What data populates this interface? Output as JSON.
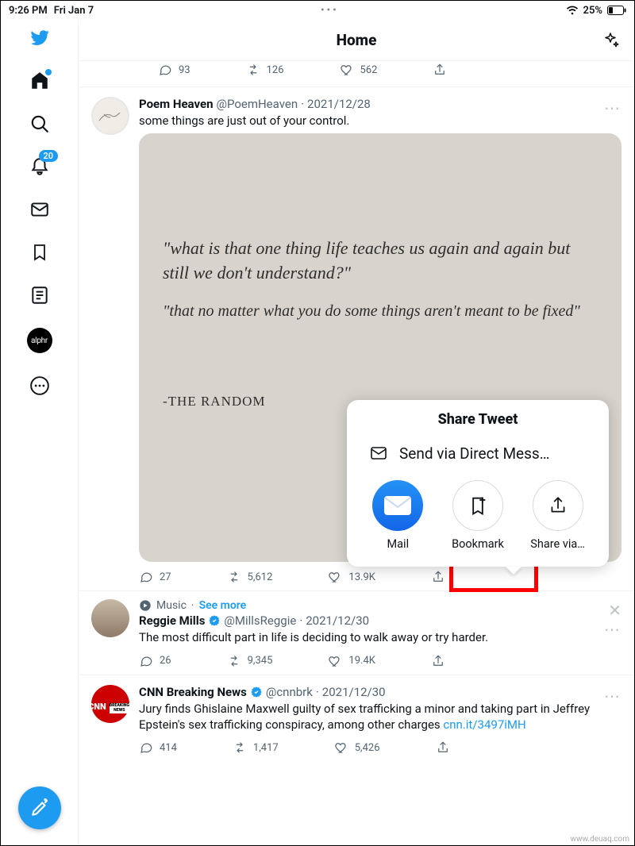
{
  "status": {
    "time": "9:26 PM",
    "date": "Fri Jan 7",
    "battery": "25%"
  },
  "header": {
    "title": "Home"
  },
  "sidebar": {
    "notifications_badge": "20",
    "profile_label": "alphr"
  },
  "prev_actions": {
    "reply": "93",
    "retweet": "126",
    "like": "562"
  },
  "tweet1": {
    "name": "Poem Heaven",
    "handle": "@PoemHeaven",
    "date": "2021/12/28",
    "text": "some things are just out of your control.",
    "quote_line1": "\"what is that one thing life teaches us again and again but still we don't understand?\"",
    "quote_line2": "\"that no matter what you do some things aren't meant to be fixed\"",
    "quote_src": "-THE RANDOM",
    "reply": "27",
    "retweet": "5,612",
    "like": "13.9K"
  },
  "share": {
    "title": "Share Tweet",
    "dm": "Send via Direct Mess…",
    "mail": "Mail",
    "bookmark": "Bookmark",
    "share_via": "Share via…"
  },
  "tweet2": {
    "topic": "Music",
    "see_more": "See more",
    "name": "Reggie Mills",
    "handle": "@MillsReggie",
    "date": "2021/12/30",
    "text": "The most difficult part in life is deciding to walk away or try harder.",
    "reply": "26",
    "retweet": "9,345",
    "like": "19.4K"
  },
  "tweet3": {
    "name": "CNN Breaking News",
    "handle": "@cnnbrk",
    "date": "2021/12/30",
    "text": "Jury finds Ghislaine Maxwell guilty of sex trafficking a minor and taking part in Jeffrey Epstein's sex trafficking conspiracy, among other charges",
    "link": "cnn.it/3497iMH",
    "reply": "414",
    "retweet": "1,417",
    "like": "5,426"
  },
  "watermark": "www.deuaq.com"
}
